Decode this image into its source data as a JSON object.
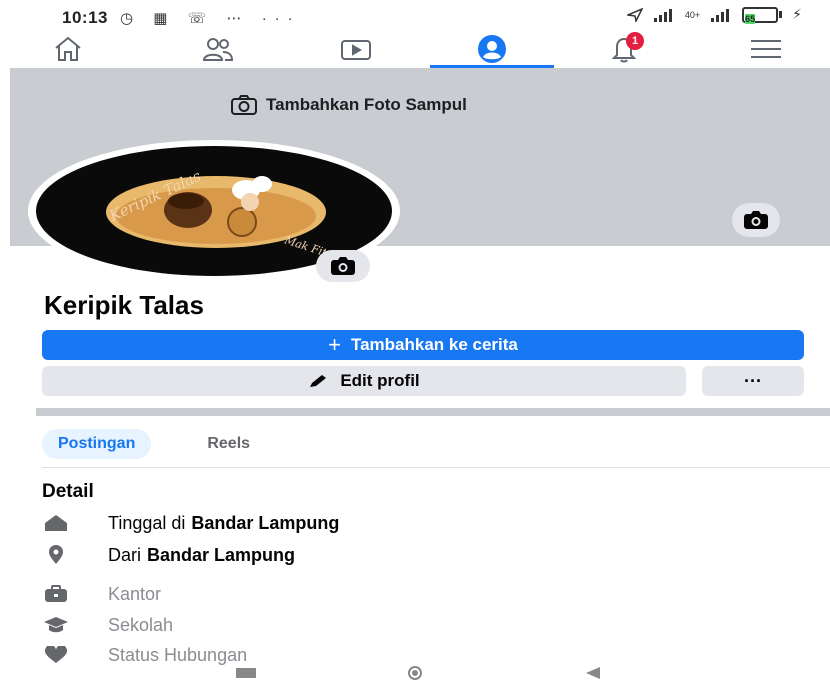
{
  "status_bar": {
    "time": "10:13",
    "left_icons": "◷ ▦ ☏ ⋯ ···",
    "signal_text": "40+",
    "battery_level": "65"
  },
  "nav": {
    "items": [
      {
        "name": "home-icon"
      },
      {
        "name": "friends-icon"
      },
      {
        "name": "video-icon"
      },
      {
        "name": "profile-icon",
        "active": true
      },
      {
        "name": "notifications-icon",
        "badge": "1"
      },
      {
        "name": "menu-icon"
      }
    ]
  },
  "cover": {
    "add_label": "Tambahkan Foto Sampul"
  },
  "profile": {
    "name": "Keripik Talas",
    "avatar_text_top": "Keripik Talas",
    "avatar_text_bottom": "Mak Fitri"
  },
  "actions": {
    "add_story_label": "Tambahkan ke cerita",
    "add_story_prefix": "+",
    "edit_profile_label": "Edit profil",
    "more_label": "···"
  },
  "tabs": [
    {
      "label": "Postingan",
      "active": true
    },
    {
      "label": "Reels",
      "active": false
    }
  ],
  "details": {
    "title": "Detail",
    "rows": [
      {
        "icon": "home-icon",
        "prefix": "Tinggal di",
        "value": "Bandar Lampung",
        "muted": false
      },
      {
        "icon": "location-pin-icon",
        "prefix": "Dari",
        "value": "Bandar Lampung",
        "muted": false
      },
      {
        "icon": "briefcase-icon",
        "prefix": "Kantor",
        "value": "",
        "muted": true
      },
      {
        "icon": "graduation-cap-icon",
        "prefix": "Sekolah",
        "value": "",
        "muted": true
      },
      {
        "icon": "heart-icon",
        "prefix": "Status Hubungan",
        "value": "",
        "muted": true
      }
    ]
  },
  "colors": {
    "primary": "#1877f2",
    "cover_bg": "#c9ccd1",
    "button_bg": "#e4e6eb",
    "badge": "#e41e3f"
  }
}
